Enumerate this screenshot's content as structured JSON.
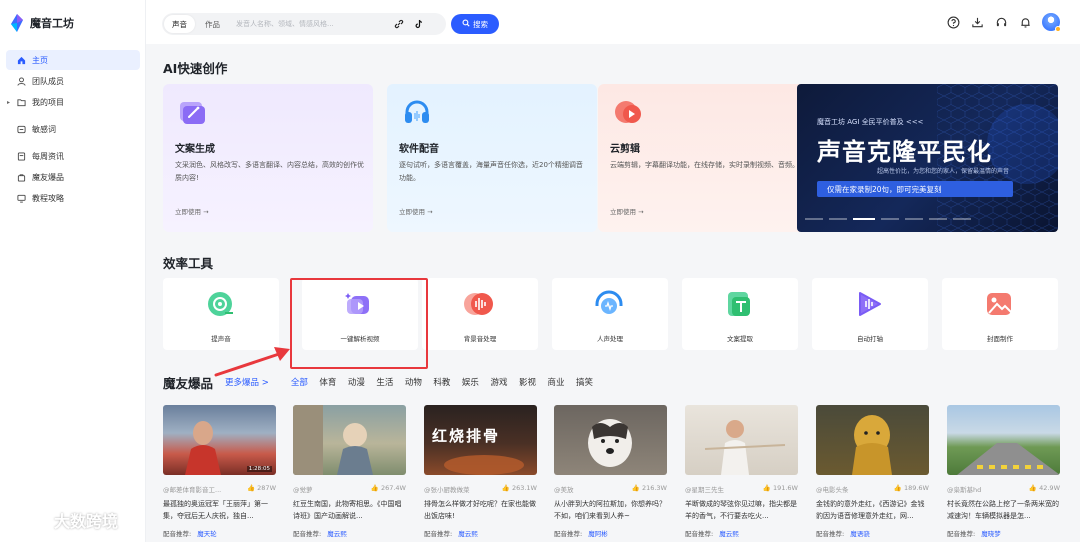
{
  "brand": {
    "name": "魔音工坊"
  },
  "nav": [
    {
      "label": "主页",
      "icon": "home-icon",
      "active": true
    },
    {
      "label": "团队成员",
      "icon": "user-icon"
    },
    {
      "label": "我的项目",
      "icon": "folder-icon",
      "expandable": true
    },
    {
      "label": "敏感词",
      "icon": "shield-icon"
    },
    {
      "label": "每周资讯",
      "icon": "calendar-icon"
    },
    {
      "label": "魔友爆品",
      "icon": "bag-icon"
    },
    {
      "label": "教程攻略",
      "icon": "monitor-icon"
    }
  ],
  "search": {
    "tabs": [
      "声音",
      "作品"
    ],
    "placeholder": "发音人名称、领域、情感风格...",
    "button": "搜索"
  },
  "sections": {
    "ai": "AI快速创作",
    "tools": "效率工具",
    "explore": "魔友爆品"
  },
  "ai_cards": [
    {
      "title": "文案生成",
      "desc": "文采润色、风格改写、多语言翻译、内容总结，高效的创作优质内容!",
      "link": "立即使用 →",
      "bg": "#efeafe",
      "accent": "#8b6cf5"
    },
    {
      "title": "软件配音",
      "desc": "逐句试听，多语言覆盖，海量声音任你选，近20个精细调音功能。",
      "link": "立即使用 →",
      "bg": "#e5f3ff",
      "accent": "#2d8cf0"
    },
    {
      "title": "云剪辑",
      "desc": "云端剪辑，字幕翻译功能，在线存储，实时录制视频、音频。",
      "link": "立即使用 →",
      "bg": "#fdebe8",
      "accent": "#f0584c"
    }
  ],
  "banner": {
    "small": "魔音工坊 AGI 全民平价普及 <<<",
    "big": "声音克隆平民化",
    "sub": "超高性价比，为您和您的家人，保留最温情的声音",
    "button": "仅需在家录制20句，即可完美复刻"
  },
  "tools": [
    {
      "label": "提声音",
      "color": "#2fbf71"
    },
    {
      "label": "一键解析视频",
      "color": "#7a5cf5"
    },
    {
      "label": "背景音处理",
      "color": "#f0584c"
    },
    {
      "label": "人声处理",
      "color": "#2d8cf0"
    },
    {
      "label": "文案提取",
      "color": "#2fbf71"
    },
    {
      "label": "自动打轴",
      "color": "#7a5cf5"
    },
    {
      "label": "封面制作",
      "color": "#f0584c"
    }
  ],
  "filters": {
    "more": "更多爆品 >",
    "items": [
      "全部",
      "体育",
      "动漫",
      "生活",
      "动物",
      "科教",
      "娱乐",
      "游戏",
      "影视",
      "商业",
      "搞笑"
    ]
  },
  "videos": [
    {
      "author": "@邮差体育影音工...",
      "likes": "287W",
      "title": "最孤独的奥运冠军「王丽萍」第一集，夺冠后无人庆祝，独自...",
      "rec_label": "配音推荐:",
      "voice": "魔天轮",
      "duration": "1:28:05"
    },
    {
      "author": "@觉萝",
      "likes": "267.4W",
      "title": "红豆生南国，此物寄相思。《中国唱诗班》国产动画解说...",
      "rec_label": "配音推荐:",
      "voice": "魔云熙",
      "duration": ""
    },
    {
      "author": "@张小厨教做菜",
      "likes": "263.1W",
      "title": "排骨怎么样做才好吃呢？在家也能做出饭店味!",
      "rec_label": "配音推荐:",
      "voice": "魔云熙",
      "duration": "",
      "overlay": "红烧排骨"
    },
    {
      "author": "@美放",
      "likes": "216.3W",
      "title": "从小胖到大的阿拉斯加，你想养吗？不如，咱们来看到人养~",
      "rec_label": "配音推荐:",
      "voice": "魔阿彬",
      "duration": ""
    },
    {
      "author": "@星期三先生",
      "likes": "191.6W",
      "title": "羊断做成的琴弦你见过嘛，指尖都是羊的香气，不行要去吃火...",
      "rec_label": "配音推荐:",
      "voice": "魔云熙",
      "duration": ""
    },
    {
      "author": "@电影头条",
      "likes": "189.6W",
      "title": "金钱豹的意外走红，《西游记》金钱豹因为语音修理意外走红，网...",
      "rec_label": "配音推荐:",
      "voice": "魔语骁",
      "duration": ""
    },
    {
      "author": "@枭斯基hd",
      "likes": "42.9W",
      "title": "村长竟然在公路上挖了一条两米宽的减速沟！车辆模拟器是怎...",
      "rec_label": "配音推荐:",
      "voice": "魔晓梦",
      "duration": ""
    }
  ],
  "watermark": "大数跨境"
}
